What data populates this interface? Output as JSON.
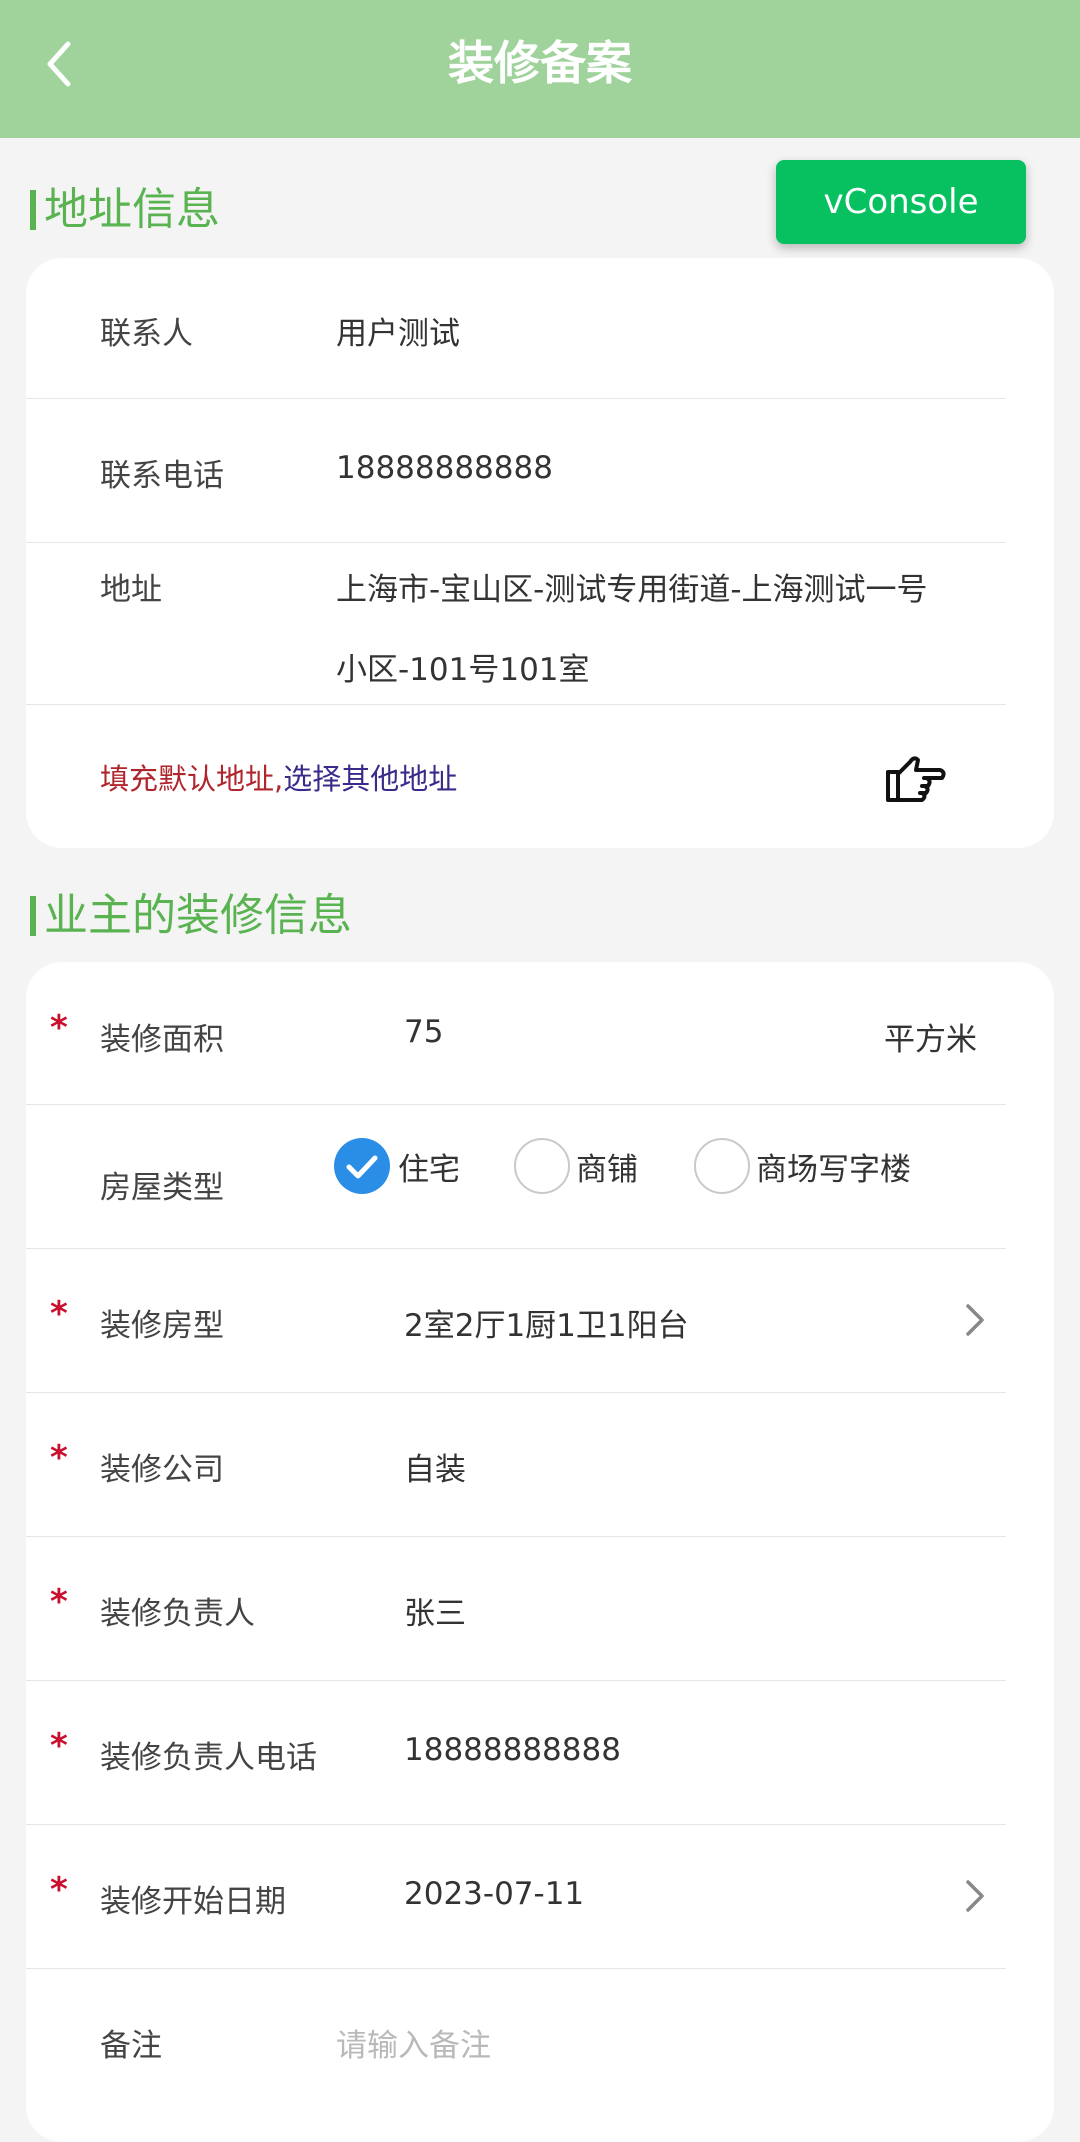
{
  "header": {
    "title": "装修备案"
  },
  "vconsole": {
    "label": "vConsole"
  },
  "address_section": {
    "title": "地址信息",
    "contact": {
      "label": "联系人",
      "value": "用户测试"
    },
    "phone": {
      "label": "联系电话",
      "value": "18888888888"
    },
    "address": {
      "label": "地址",
      "line1": "上海市-宝山区-测试专用街道-上海测试一号",
      "line2": "小区-101号101室"
    },
    "actions": {
      "fill_default": "填充默认地址,",
      "choose_other": "选择其他地址"
    }
  },
  "decoration_section": {
    "title": "业主的装修信息",
    "area": {
      "label": "装修面积",
      "value": "75",
      "unit": "平方米"
    },
    "house_type": {
      "label": "房屋类型",
      "options": [
        "住宅",
        "商铺",
        "商场写字楼"
      ],
      "selected": "住宅"
    },
    "layout": {
      "label": "装修房型",
      "value": "2室2厅1厨1卫1阳台"
    },
    "company": {
      "label": "装修公司",
      "value": "自装"
    },
    "manager": {
      "label": "装修负责人",
      "value": "张三"
    },
    "manager_phone": {
      "label": "装修负责人电话",
      "value": "18888888888"
    },
    "start_date": {
      "label": "装修开始日期",
      "value": "2023-07-11"
    },
    "remark": {
      "label": "备注",
      "placeholder": "请输入备注"
    },
    "required_mark": "*"
  },
  "colors": {
    "header_bg": "#a0d39b",
    "accent_green": "#5ab351",
    "vconsole_green": "#07c160",
    "required_red": "#c8102e",
    "radio_blue": "#2a8de6"
  },
  "icons": {
    "back": "chevron-left-icon",
    "pointing_hand": "pointing-hand-icon",
    "chevron": "chevron-right-icon",
    "check": "check-icon"
  }
}
